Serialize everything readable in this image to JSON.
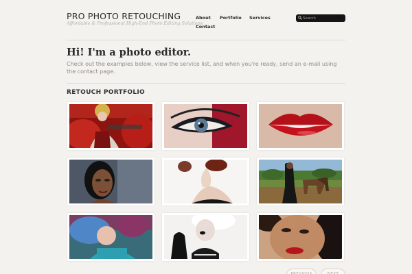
{
  "header": {
    "site_title": "PRO PHOTO RETOUCHING",
    "tagline": "Affordable & Professional High-End Photo Editing Solutions"
  },
  "nav": {
    "items": [
      {
        "label": "About"
      },
      {
        "label": "Portfolio"
      },
      {
        "label": "Services"
      },
      {
        "label": "Contact"
      }
    ]
  },
  "search": {
    "placeholder": "Search"
  },
  "intro": {
    "headline": "Hi! I'm a photo editor.",
    "text": "Check out the examples below, view the service list, and when you're ready, send an e-mail using the contact page."
  },
  "portfolio": {
    "title": "RETOUCH PORTFOLIO"
  },
  "pager": {
    "previous": "PREVIOUS",
    "next": "NEXT"
  },
  "colors": {
    "background": "#f4f2ee",
    "search_bg": "#151515",
    "rule": "#dcd9d3"
  }
}
